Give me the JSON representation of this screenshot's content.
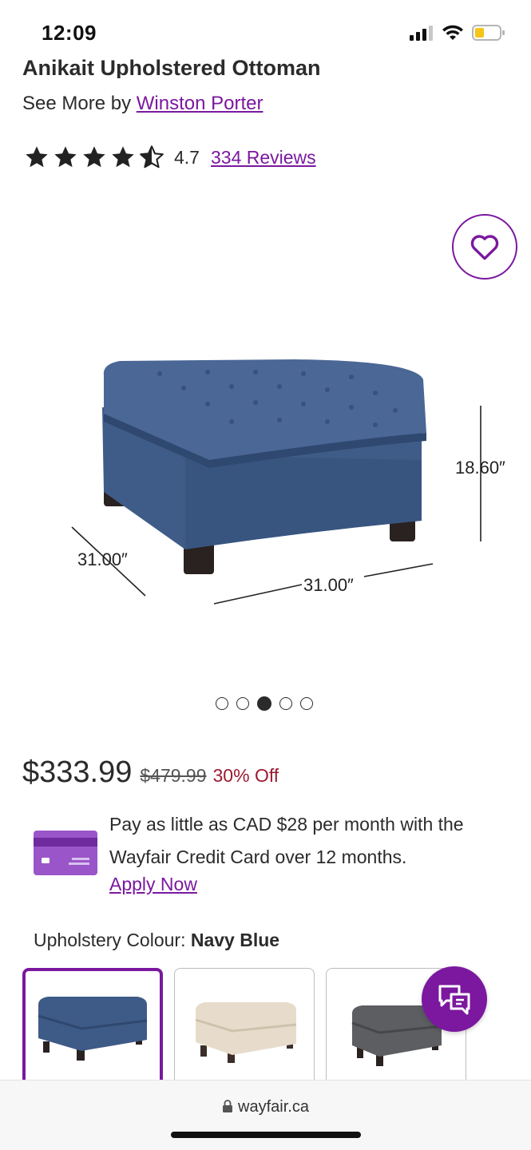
{
  "status_bar": {
    "time": "12:09",
    "icons": [
      "signal-icon",
      "wifi-icon",
      "battery-icon"
    ]
  },
  "product": {
    "title": "Anikait Upholstered Ottoman",
    "see_more_prefix": "See More by",
    "brand": "Winston Porter",
    "rating": "4.7",
    "star_rating": 4.7,
    "reviews_label": "334 Reviews"
  },
  "image": {
    "dimensions": {
      "height": "18.60″",
      "depth": "31.00″",
      "width": "31.00″"
    },
    "carousel": {
      "count": 5,
      "active_index": 3
    }
  },
  "pricing": {
    "price": "$333.99",
    "original_price": "$479.99",
    "discount": "30% Off"
  },
  "credit": {
    "text": "Pay as little as CAD $28 per month with the Wayfair Credit Card over 12 months.",
    "apply_label": "Apply Now"
  },
  "colour": {
    "label": "Upholstery Colour:",
    "selected": "Navy Blue",
    "options": [
      {
        "name": "Navy Blue",
        "color": "#3e5a86"
      },
      {
        "name": "Beige",
        "color": "#e7dccb"
      },
      {
        "name": "Charcoal",
        "color": "#5c5e61"
      }
    ]
  },
  "browser": {
    "url": "wayfair.ca"
  },
  "colors": {
    "accent": "#7b189f",
    "discount": "#9b1b30",
    "text": "#2b2b2b"
  }
}
